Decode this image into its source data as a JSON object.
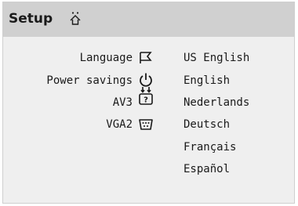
{
  "header": {
    "title": "Setup",
    "title_icon": "setup-home-icon"
  },
  "menu": {
    "items": [
      {
        "label": "Language",
        "icon": "flag-icon"
      },
      {
        "label": "Power savings",
        "icon": "power-icon"
      },
      {
        "label": "AV3",
        "icon": "av-connection-icon"
      },
      {
        "label": "VGA2",
        "icon": "vga-connector-icon"
      }
    ]
  },
  "options": {
    "items": [
      "US English",
      "English",
      "Nederlands",
      "Deutsch",
      "Français",
      "Español"
    ]
  }
}
